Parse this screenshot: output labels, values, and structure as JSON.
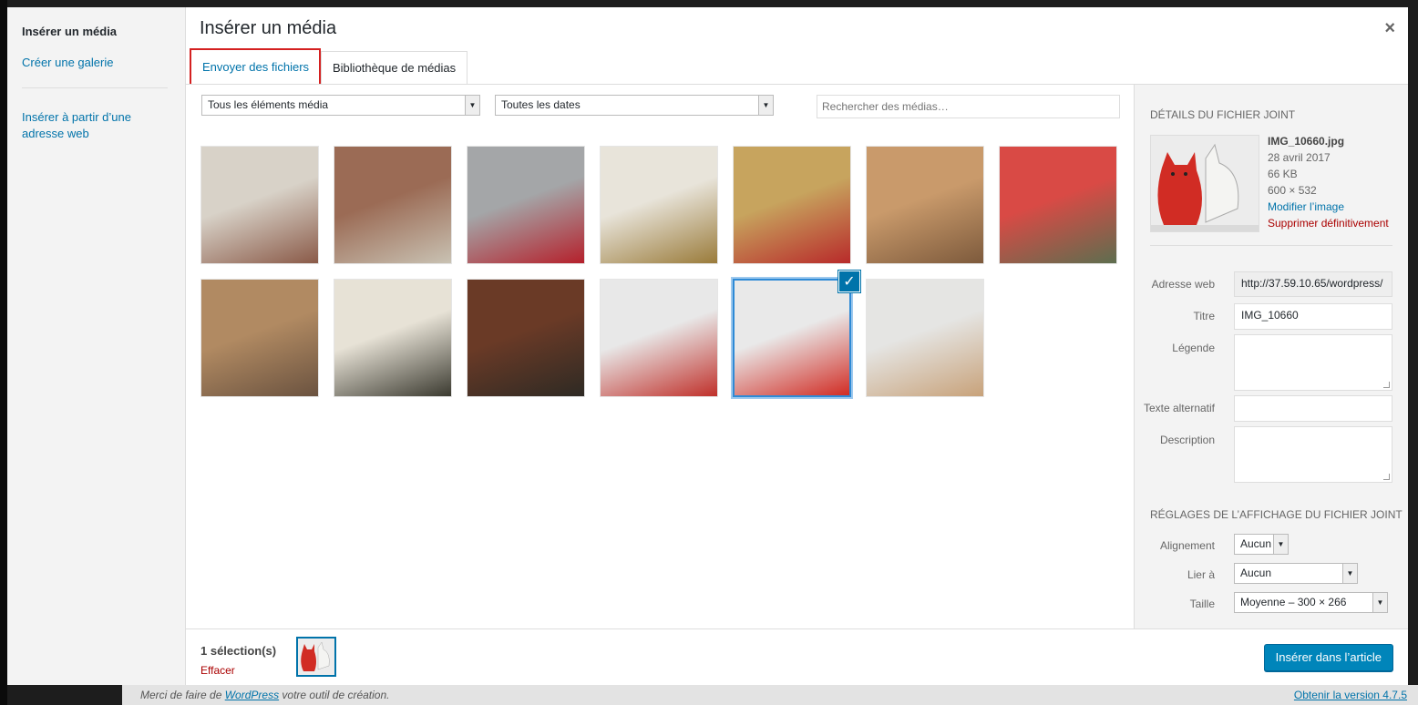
{
  "menu": {
    "active": "Insérer un média",
    "items": [
      {
        "label": "Créer une galerie"
      },
      {
        "label": "Insérer à partir d’une adresse web"
      }
    ]
  },
  "frame": {
    "title": "Insérer un média",
    "close_glyph": "×"
  },
  "tabs": [
    {
      "label": "Envoyer des fichiers",
      "active": false
    },
    {
      "label": "Bibliothèque de médias",
      "active": true
    }
  ],
  "filters": {
    "type_selected": "Tous les éléments média",
    "date_selected": "Toutes les dates",
    "search_placeholder": "Rechercher des médias…"
  },
  "library": {
    "items": [
      {
        "subject": "butchers-counter",
        "colors": [
          "#d8d2c8",
          "#8a5a48"
        ]
      },
      {
        "subject": "woman-at-register",
        "colors": [
          "#9b6b55",
          "#c9c2b3"
        ]
      },
      {
        "subject": "store-interior-checkout",
        "colors": [
          "#a4a6a8",
          "#b5202b"
        ]
      },
      {
        "subject": "produce-crates",
        "colors": [
          "#e8e4da",
          "#9a7b3a"
        ]
      },
      {
        "subject": "melons-and-strawberries",
        "colors": [
          "#c7a45e",
          "#b82a2a"
        ]
      },
      {
        "subject": "shelves-of-goods",
        "colors": [
          "#c99a6b",
          "#7d5a3c"
        ]
      },
      {
        "subject": "store-shelves-wide",
        "colors": [
          "#d94a45",
          "#5d6e4f"
        ]
      },
      {
        "subject": "bakery-display",
        "colors": [
          "#b18a62",
          "#6b5340"
        ]
      },
      {
        "subject": "wine-shelving",
        "colors": [
          "#e7e2d6",
          "#3b3a30"
        ]
      },
      {
        "subject": "wine-bottles",
        "colors": [
          "#6a3a26",
          "#2e2a24"
        ]
      },
      {
        "subject": "ceramic-lanterns",
        "colors": [
          "#e8e8e8",
          "#c0302a"
        ]
      },
      {
        "subject": "ceramic-cats",
        "colors": [
          "#e9e9e9",
          "#d12c24"
        ],
        "selected": true
      },
      {
        "subject": "ceramic-utensil-pots",
        "colors": [
          "#e5e5e3",
          "#c8a27a"
        ]
      }
    ]
  },
  "details": {
    "heading": "Détails du fichier joint",
    "filename": "IMG_10660.jpg",
    "date": "28 avril 2017",
    "size": "66 KB",
    "dimensions": "600 × 532",
    "edit_link": "Modifier l’image",
    "delete_link": "Supprimer définitivement",
    "fields": {
      "url_label": "Adresse web",
      "url_value": "http://37.59.10.65/wordpress/",
      "title_label": "Titre",
      "title_value": "IMG_10660",
      "caption_label": "Légende",
      "alt_label": "Texte alternatif",
      "description_label": "Description"
    }
  },
  "display_settings": {
    "heading": "Réglages de l’affichage du fichier joint",
    "alignment_label": "Alignement",
    "alignment_value": "Aucun",
    "link_label": "Lier à",
    "link_value": "Aucun",
    "size_label": "Taille",
    "size_value": "Moyenne – 300 × 266"
  },
  "toolbar": {
    "selection_count": "1 sélection(s)",
    "clear_label": "Effacer",
    "insert_button": "Insérer dans l’article"
  },
  "background_footer": {
    "text_before": "Merci de faire de",
    "link": "WordPress",
    "text_after": "votre outil de création.",
    "version_link": "Obtenir la version 4.7.5"
  },
  "colors": {
    "accent": "#0073aa",
    "button": "#0085ba",
    "danger": "#a00",
    "highlight_outline": "#d42020"
  }
}
